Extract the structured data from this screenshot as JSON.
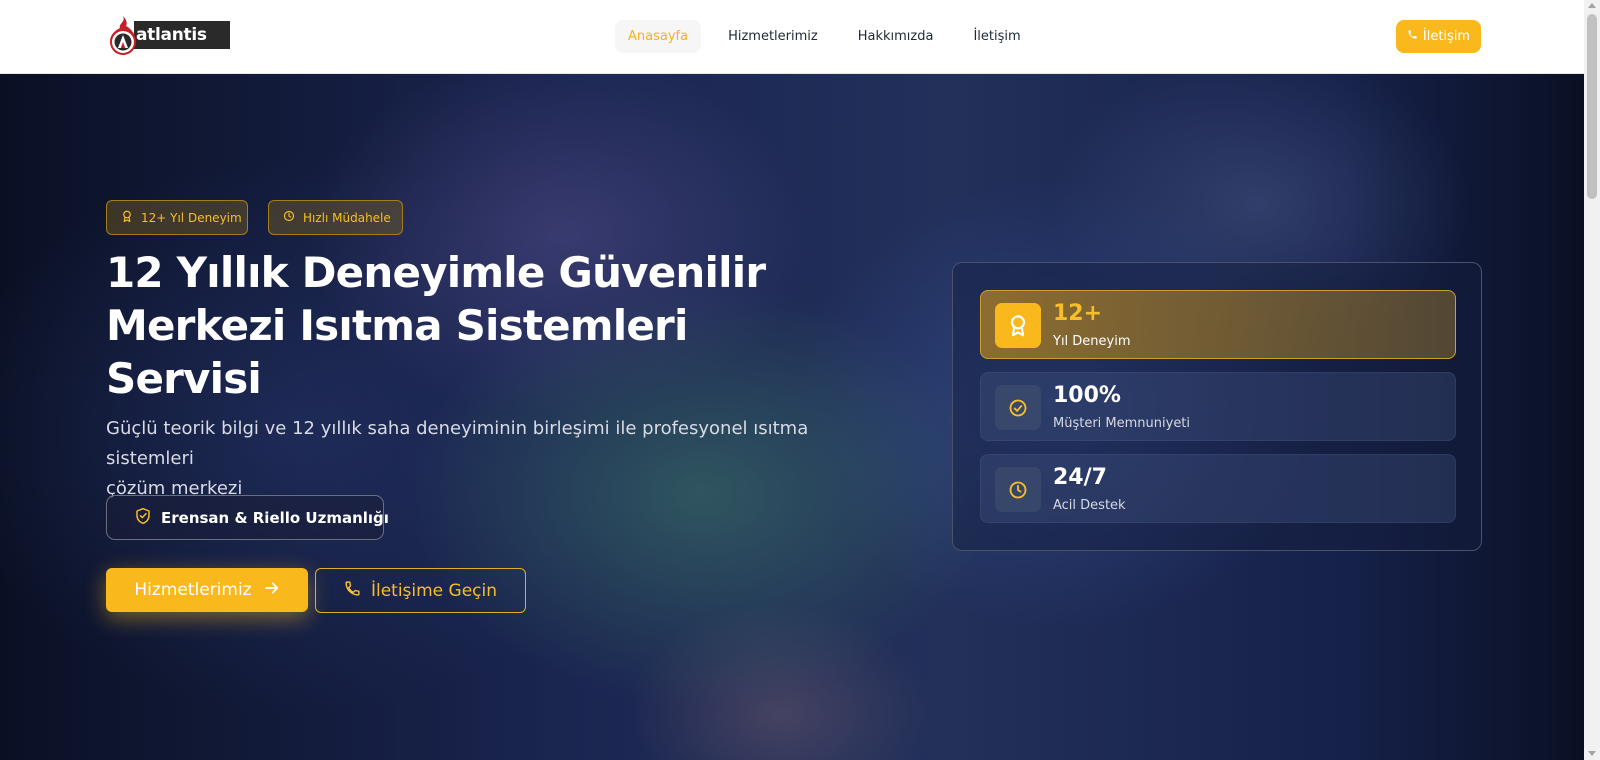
{
  "brand": {
    "name": "atlantis ısı"
  },
  "nav": {
    "items": [
      {
        "label": "Anasayfa",
        "active": true
      },
      {
        "label": "Hizmetlerimiz",
        "active": false
      },
      {
        "label": "Hakkımızda",
        "active": false
      },
      {
        "label": "İletişim",
        "active": false
      }
    ],
    "cta_label": "İletişim"
  },
  "hero": {
    "pills": [
      {
        "label": "12+ Yıl Deneyim",
        "icon": "award-icon"
      },
      {
        "label": "Hızlı Müdahele",
        "icon": "clock-icon"
      }
    ],
    "title_lines": [
      "12 Yıllık Deneyimle Güvenilir",
      "Merkezi Isıtma Sistemleri",
      "Servisi"
    ],
    "subtitle_lines": [
      "Güçlü teorik bilgi ve 12 yıllık saha deneyiminin birleşimi ile profesyonel ısıtma sistemleri",
      "çözüm merkezi"
    ],
    "badge_label": "Erensan & Riello Uzmanlığı",
    "primary_button": "Hizmetlerimiz",
    "secondary_button": "İletişime Geçin"
  },
  "stats": [
    {
      "value": "12+",
      "label": "Yıl Deneyim",
      "icon": "award-icon",
      "highlighted": true
    },
    {
      "value": "100%",
      "label": "Müşteri Memnuniyeti",
      "icon": "check-circle-icon",
      "highlighted": false
    },
    {
      "value": "24/7",
      "label": "Acil Destek",
      "icon": "clock-icon",
      "highlighted": false
    }
  ],
  "colors": {
    "accent": "#f9b81c",
    "header_bg": "#ffffff",
    "hero_dark": "#0b1226",
    "nav_text": "#1f2a37"
  }
}
